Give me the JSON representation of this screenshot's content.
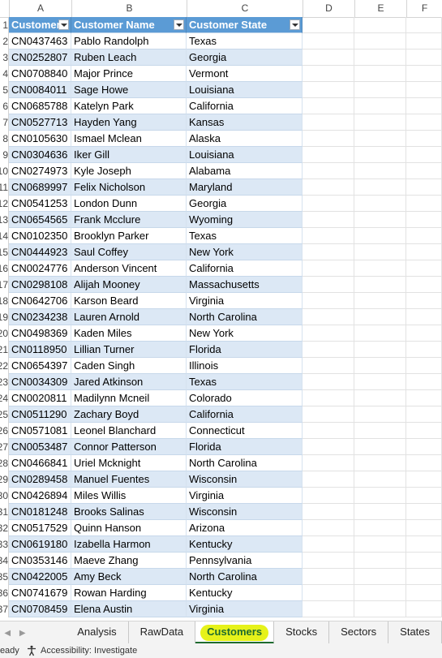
{
  "columns": [
    "A",
    "B",
    "C",
    "D",
    "E",
    "F"
  ],
  "header_row": {
    "row_num": "1",
    "a": "Customer",
    "b": "Customer Name",
    "c": "Customer State"
  },
  "rows": [
    {
      "n": "2",
      "id": "CN0437463",
      "name": "Pablo Randolph",
      "state": "Texas"
    },
    {
      "n": "3",
      "id": "CN0252807",
      "name": "Ruben Leach",
      "state": "Georgia"
    },
    {
      "n": "4",
      "id": "CN0708840",
      "name": "Major Prince",
      "state": "Vermont"
    },
    {
      "n": "5",
      "id": "CN0084011",
      "name": "Sage Howe",
      "state": "Louisiana"
    },
    {
      "n": "6",
      "id": "CN0685788",
      "name": "Katelyn Park",
      "state": "California"
    },
    {
      "n": "7",
      "id": "CN0527713",
      "name": "Hayden Yang",
      "state": "Kansas"
    },
    {
      "n": "8",
      "id": "CN0105630",
      "name": "Ismael Mclean",
      "state": "Alaska"
    },
    {
      "n": "9",
      "id": "CN0304636",
      "name": "Iker Gill",
      "state": "Louisiana"
    },
    {
      "n": "10",
      "id": "CN0274973",
      "name": "Kyle Joseph",
      "state": "Alabama"
    },
    {
      "n": "11",
      "id": "CN0689997",
      "name": "Felix Nicholson",
      "state": "Maryland"
    },
    {
      "n": "12",
      "id": "CN0541253",
      "name": "London Dunn",
      "state": "Georgia"
    },
    {
      "n": "13",
      "id": "CN0654565",
      "name": "Frank Mcclure",
      "state": "Wyoming"
    },
    {
      "n": "14",
      "id": "CN0102350",
      "name": "Brooklyn Parker",
      "state": "Texas"
    },
    {
      "n": "15",
      "id": "CN0444923",
      "name": "Saul Coffey",
      "state": "New York"
    },
    {
      "n": "16",
      "id": "CN0024776",
      "name": "Anderson Vincent",
      "state": "California"
    },
    {
      "n": "17",
      "id": "CN0298108",
      "name": "Alijah Mooney",
      "state": "Massachusetts"
    },
    {
      "n": "18",
      "id": "CN0642706",
      "name": "Karson Beard",
      "state": "Virginia"
    },
    {
      "n": "19",
      "id": "CN0234238",
      "name": "Lauren Arnold",
      "state": "North Carolina"
    },
    {
      "n": "20",
      "id": "CN0498369",
      "name": "Kaden Miles",
      "state": "New York"
    },
    {
      "n": "21",
      "id": "CN0118950",
      "name": "Lillian Turner",
      "state": "Florida"
    },
    {
      "n": "22",
      "id": "CN0654397",
      "name": "Caden Singh",
      "state": "Illinois"
    },
    {
      "n": "23",
      "id": "CN0034309",
      "name": "Jared Atkinson",
      "state": "Texas"
    },
    {
      "n": "24",
      "id": "CN0020811",
      "name": "Madilynn Mcneil",
      "state": "Colorado"
    },
    {
      "n": "25",
      "id": "CN0511290",
      "name": "Zachary Boyd",
      "state": "California"
    },
    {
      "n": "26",
      "id": "CN0571081",
      "name": "Leonel Blanchard",
      "state": "Connecticut"
    },
    {
      "n": "27",
      "id": "CN0053487",
      "name": "Connor Patterson",
      "state": "Florida"
    },
    {
      "n": "28",
      "id": "CN0466841",
      "name": "Uriel Mcknight",
      "state": "North Carolina"
    },
    {
      "n": "29",
      "id": "CN0289458",
      "name": "Manuel Fuentes",
      "state": "Wisconsin"
    },
    {
      "n": "30",
      "id": "CN0426894",
      "name": "Miles Willis",
      "state": "Virginia"
    },
    {
      "n": "31",
      "id": "CN0181248",
      "name": "Brooks Salinas",
      "state": "Wisconsin"
    },
    {
      "n": "32",
      "id": "CN0517529",
      "name": "Quinn Hanson",
      "state": "Arizona"
    },
    {
      "n": "33",
      "id": "CN0619180",
      "name": "Izabella Harmon",
      "state": "Kentucky"
    },
    {
      "n": "34",
      "id": "CN0353146",
      "name": "Maeve Zhang",
      "state": "Pennsylvania"
    },
    {
      "n": "35",
      "id": "CN0422005",
      "name": "Amy Beck",
      "state": "North Carolina"
    },
    {
      "n": "36",
      "id": "CN0741679",
      "name": "Rowan Harding",
      "state": "Kentucky"
    },
    {
      "n": "37",
      "id": "CN0708459",
      "name": "Elena Austin",
      "state": "Virginia"
    }
  ],
  "sheet_tabs": [
    "Analysis",
    "RawData",
    "Customers",
    "Stocks",
    "Sectors",
    "States"
  ],
  "active_tab": "Customers",
  "status": {
    "ready": "Ready",
    "accessibility": "Accessibility: Investigate"
  },
  "colors": {
    "table_header": "#5b9bd5",
    "band": "#dce8f5",
    "highlight": "#d6ee1a",
    "active_tab": "#1e6b2f"
  }
}
